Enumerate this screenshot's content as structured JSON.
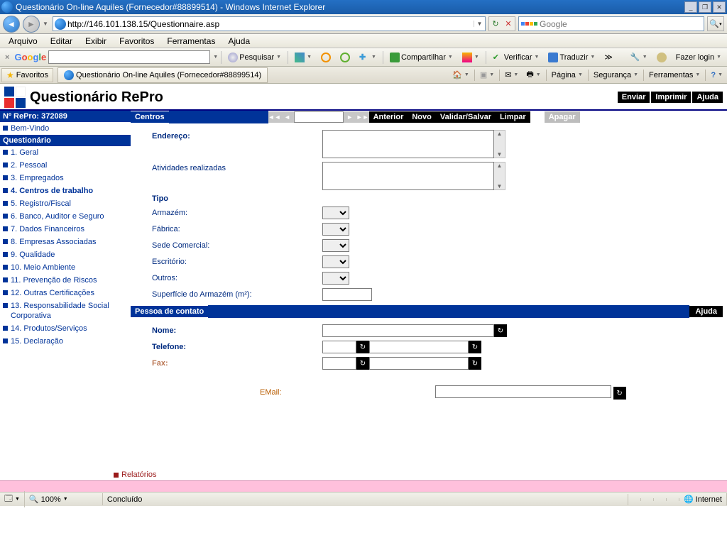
{
  "titlebar": {
    "title": "Questionário On-line Aquiles (Fornecedor#88899514) - Windows Internet Explorer"
  },
  "addressbar": {
    "url": "http://146.101.138.15/Questionnaire.asp",
    "search_provider": "Google"
  },
  "menubar": [
    "Arquivo",
    "Editar",
    "Exibir",
    "Favoritos",
    "Ferramentas",
    "Ajuda"
  ],
  "google_toolbar": {
    "search_btn": "Pesquisar",
    "share": "Compartilhar",
    "verify": "Verificar",
    "translate": "Traduzir",
    "login": "Fazer login"
  },
  "favbar": {
    "favorites": "Favoritos",
    "tab_title": "Questionário On-line Aquiles (Fornecedor#88899514)",
    "pagina": "Página",
    "seguranca": "Segurança",
    "ferramentas": "Ferramentas"
  },
  "app_header": {
    "title": "Questionário RePro",
    "enviar": "Enviar",
    "imprimir": "Imprimir",
    "ajuda": "Ajuda"
  },
  "sidebar": {
    "repro": "Nº RePro: 372089",
    "bemvindo": "Bem-Vindo",
    "quest": "Questionário",
    "items": [
      "1. Geral",
      "2. Pessoal",
      "3. Empregados",
      "4. Centros de trabalho",
      "5. Registro/Fiscal",
      "6. Banco, Auditor e Seguro",
      "7. Dados Financeiros",
      "8. Empresas Associadas",
      "9. Qualidade",
      "10. Meio Ambiente",
      "11. Prevenção de Riscos",
      "12. Outras Certificações",
      "13. Responsabilidade Social Corporativa",
      "14. Produtos/Serviços",
      "15. Declaração"
    ],
    "relatorios": "Relatórios"
  },
  "centros": {
    "title": "Centros",
    "anterior": "Anterior",
    "novo": "Novo",
    "validar": "Validar/Salvar",
    "limpar": "Limpar",
    "apagar": "Apagar",
    "endereco": "Endereço:",
    "atividades": "Atividades realizadas",
    "tipo": "Tipo",
    "armazem": "Armazém:",
    "fabrica": "Fábrica:",
    "sede": "Sede Comercial:",
    "escritorio": "Escritório:",
    "outros": "Outros:",
    "superficie": "Superfície do Armazém (m²):"
  },
  "contato": {
    "title": "Pessoa de contato",
    "ajuda": "Ajuda",
    "nome": "Nome:",
    "telefone": "Telefone:",
    "fax": "Fax:",
    "email": "EMail:"
  },
  "status": {
    "zoom": "100%",
    "concluido": "Concluído",
    "internet": "Internet"
  }
}
